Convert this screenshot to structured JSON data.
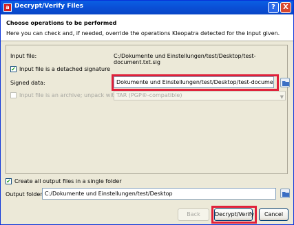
{
  "window": {
    "title": "Decrypt/Verify Files",
    "help_symbol": "?",
    "close_symbol": "X"
  },
  "header": {
    "title": "Choose operations to be performed",
    "subtitle": "Here you can check and, if needed, override the operations Kleopatra detected for the input given."
  },
  "input_file": {
    "label": "Input file:",
    "value": "C:/Dokumente und Einstellungen/test/Desktop/test-document.txt.sig"
  },
  "detached_signature": {
    "label": "Input file is a detached signature",
    "checked": true
  },
  "signed_data": {
    "label": "Signed data:",
    "value": "Dokumente und Einstellungen/test/Desktop/test-document.txt"
  },
  "archive": {
    "label": "Input file is an archive; unpack with:",
    "checked": false,
    "enabled": false,
    "selected": "TAR (PGP®-compatible)"
  },
  "single_folder": {
    "label": "Create all output files in a single folder",
    "checked": true
  },
  "output_folder": {
    "label": "Output folder:",
    "value": "C:/Dokumente und Einstellungen/test/Desktop"
  },
  "buttons": {
    "back": "Back",
    "decrypt_verify": "Decrypt/Verify",
    "cancel": "Cancel"
  },
  "colors": {
    "highlight": "#e0203a",
    "titlebar": "#0a5fe3"
  }
}
